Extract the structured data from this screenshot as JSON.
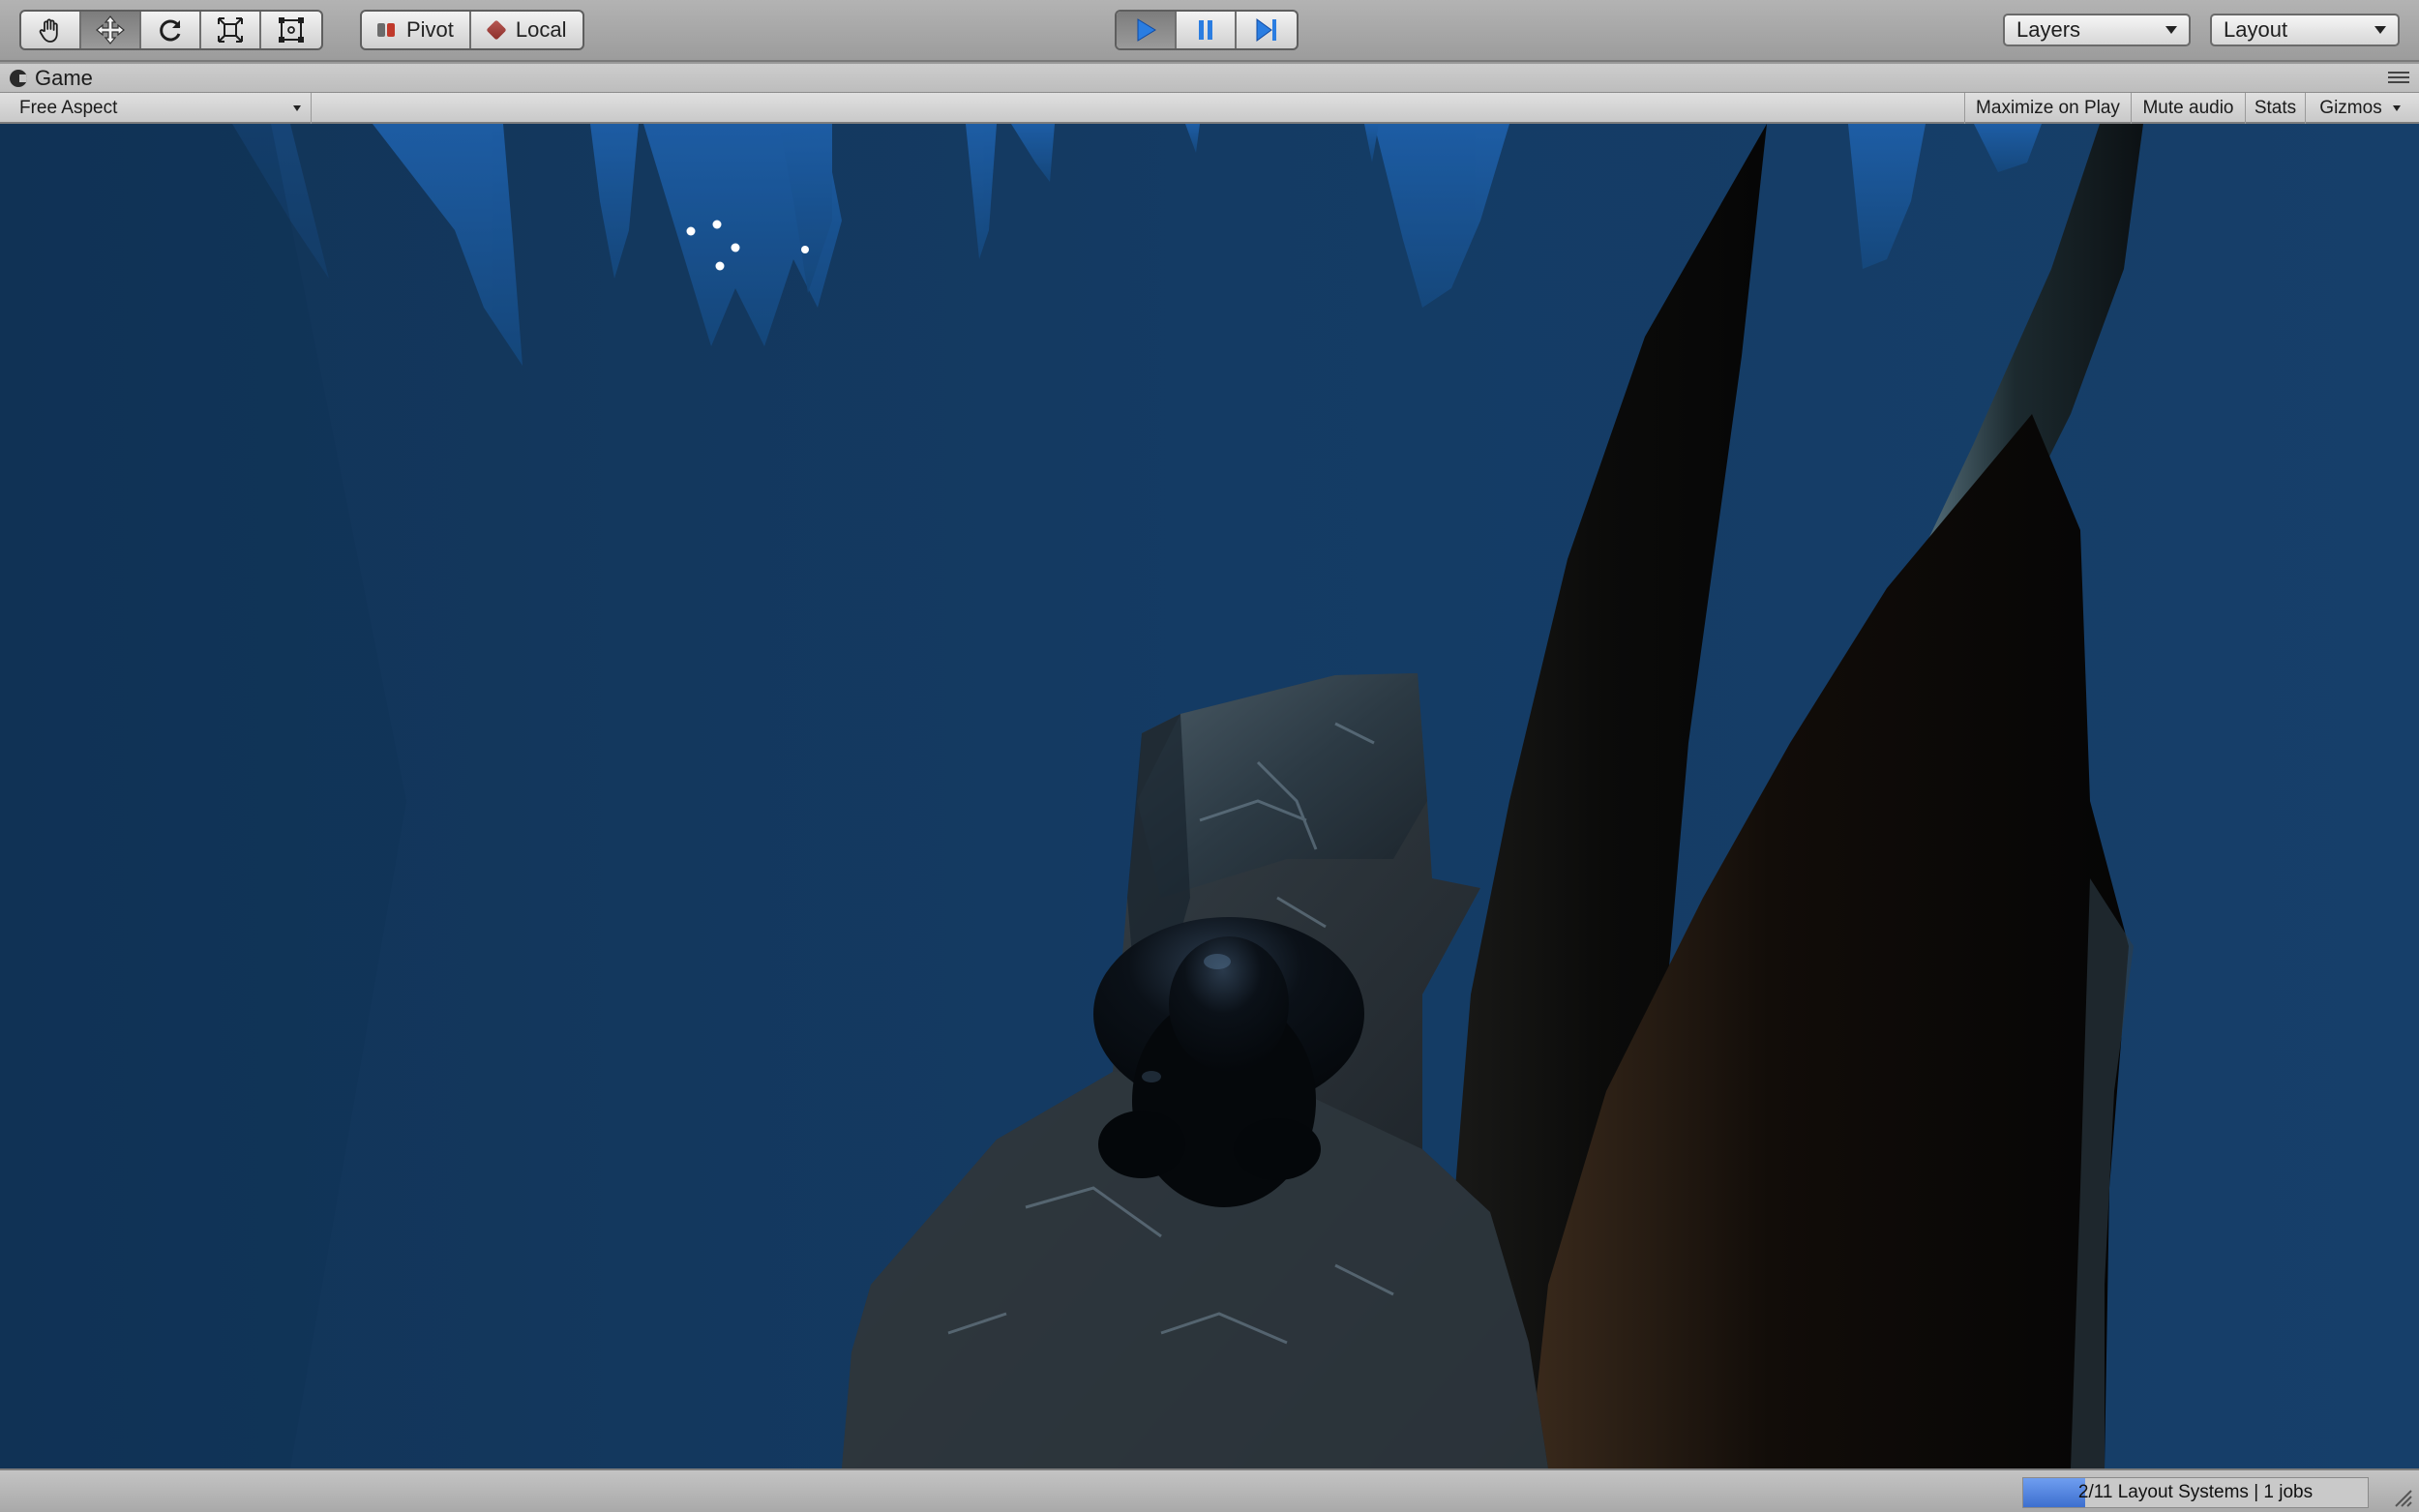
{
  "toolbar": {
    "tools": [
      {
        "name": "hand-tool",
        "icon": "hand-icon"
      },
      {
        "name": "move-tool",
        "icon": "move-icon",
        "active": true
      },
      {
        "name": "rotate-tool",
        "icon": "rotate-icon"
      },
      {
        "name": "scale-tool",
        "icon": "scale-icon"
      },
      {
        "name": "rect-tool",
        "icon": "rect-icon"
      }
    ],
    "pivot_label": "Pivot",
    "local_label": "Local",
    "play_controls": [
      "play-icon",
      "pause-icon",
      "step-icon"
    ],
    "layers_label": "Layers",
    "layout_label": "Layout"
  },
  "game_window": {
    "tab_label": "Game",
    "aspect_label": "Free Aspect",
    "maximize_label": "Maximize on Play",
    "mute_label": "Mute audio",
    "stats_label": "Stats",
    "gizmos_label": "Gizmos"
  },
  "status": {
    "progress_text": "2/11 Layout Systems | 1 jobs",
    "progress_fraction": 0.18
  },
  "colors": {
    "play_blue": "#2a7de1",
    "sky": "#143a62",
    "progress_blue": "#4a7ddb"
  }
}
